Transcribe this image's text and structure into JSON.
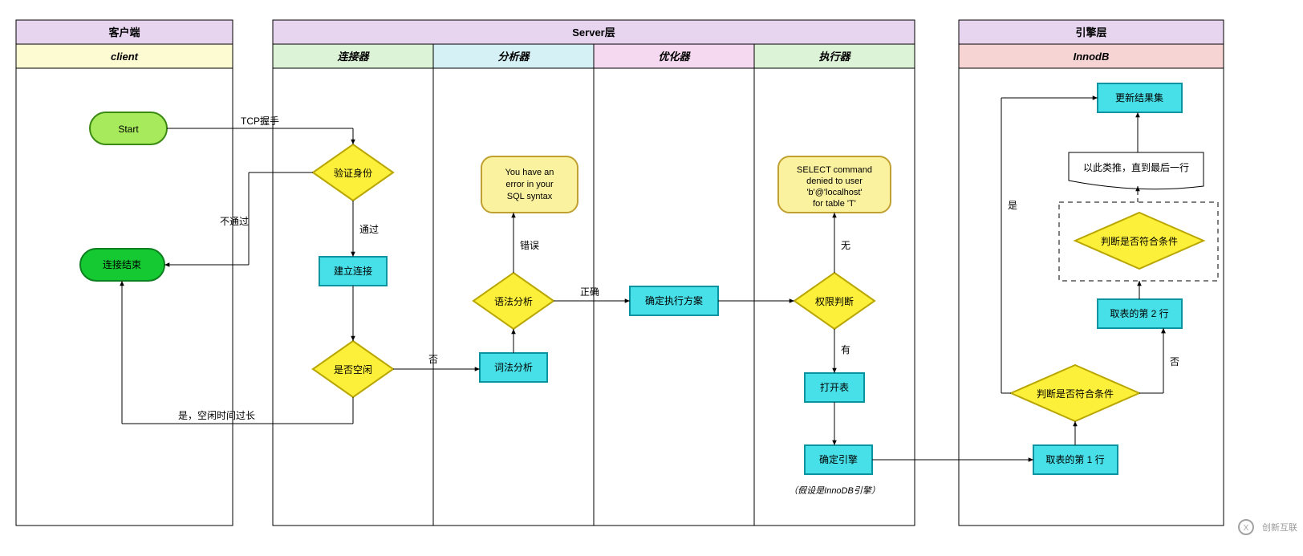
{
  "lanes": {
    "client": {
      "title": "客户端",
      "sub": "client"
    },
    "server": {
      "title": "Server层"
    },
    "connector": {
      "title": "连接器"
    },
    "analyzer": {
      "title": "分析器"
    },
    "optimizer": {
      "title": "优化器"
    },
    "executor": {
      "title": "执行器"
    },
    "engine": {
      "title": "引擎层",
      "sub": "InnodB"
    }
  },
  "nodes": {
    "start": "Start",
    "connect_end": "连接结束",
    "verify_identity": "验证身份",
    "establish_conn": "建立连接",
    "is_idle": "是否空闲",
    "lexical": "词法分析",
    "syntax": "语法分析",
    "sql_error": "You have an error in your SQL syntax",
    "plan": "确定执行方案",
    "perm_check": "权限判断",
    "perm_denied": "SELECT command denied to user 'b'@'localhost' for table 'T'",
    "open_table": "打开表",
    "determine_engine": "确定引擎",
    "engine_note": "（假设是InnoDB引擎）",
    "row1": "取表的第 1 行",
    "cond1": "判断是否符合条件",
    "row2": "取表的第 2 行",
    "cond2": "判断是否符合条件",
    "loop_note": "以此类推，直到最后一行",
    "update_result": "更新结果集"
  },
  "edges": {
    "tcp": "TCP握手",
    "fail": "不通过",
    "pass": "通过",
    "no": "否",
    "idle_long": "是，空闲时间过长",
    "correct": "正确",
    "error": "错误",
    "none": "无",
    "has": "有",
    "no2": "否",
    "yes": "是"
  },
  "watermark": "创新互联"
}
